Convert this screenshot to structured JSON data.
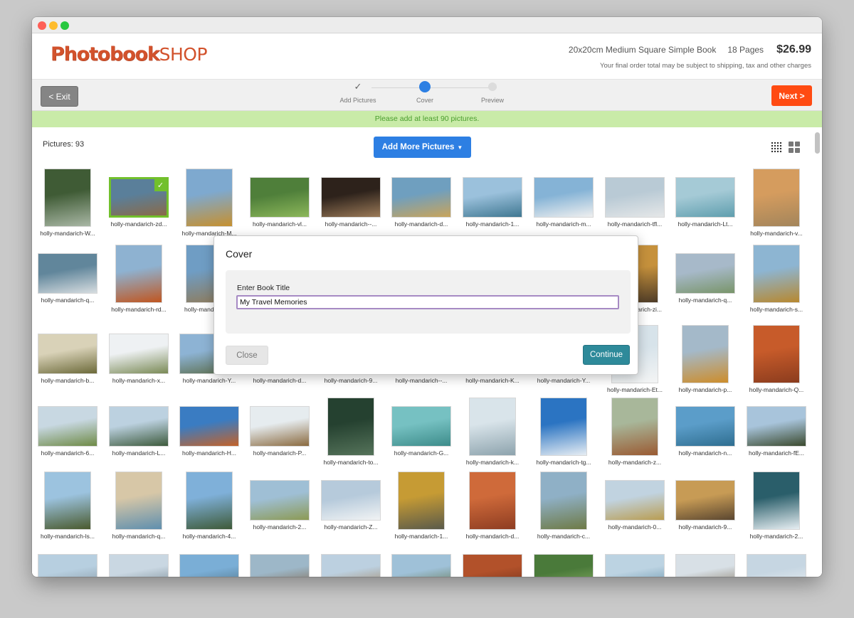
{
  "header": {
    "logo_bold": "Photobook",
    "logo_light": "SHOP",
    "product_name": "20x20cm Medium Square Simple Book",
    "pages": "18 Pages",
    "price": "$26.99",
    "note": "Your final order total may be subject to shipping, tax and other charges"
  },
  "toolbar": {
    "exit_label": "< Exit",
    "next_label": "Next >",
    "steps": [
      {
        "label": "Add Pictures",
        "state": "done"
      },
      {
        "label": "Cover",
        "state": "active"
      },
      {
        "label": "Preview",
        "state": "todo"
      }
    ]
  },
  "alert": {
    "text": "Please add at least 90 pictures."
  },
  "gallery": {
    "count_label": "Pictures: 93",
    "add_button": "Add More Pictures",
    "photos": [
      {
        "name": "holly-mandarich-W...",
        "c1": "#3f5b35",
        "c2": "#a9b7a5",
        "o": "p",
        "sel": false
      },
      {
        "name": "holly-mandarich-zd...",
        "c1": "#5a7f9a",
        "c2": "#8a6a48",
        "o": "l",
        "sel": true
      },
      {
        "name": "holly-mandarich-M...",
        "c1": "#7ea9cf",
        "c2": "#c6902f",
        "o": "p",
        "sel": false
      },
      {
        "name": "holly-mandarich-vl...",
        "c1": "#4f7f3a",
        "c2": "#8cb75a",
        "o": "l",
        "sel": false
      },
      {
        "name": "holly-mandarich--...",
        "c1": "#2d221b",
        "c2": "#9b7a58",
        "o": "l",
        "sel": false
      },
      {
        "name": "holly-mandarich-d...",
        "c1": "#6f9fbf",
        "c2": "#c9a45a",
        "o": "l",
        "sel": false
      },
      {
        "name": "holly-mandarich-1...",
        "c1": "#9bc1dc",
        "c2": "#3f7791",
        "o": "l",
        "sel": false
      },
      {
        "name": "holly-mandarich-m...",
        "c1": "#85b3d6",
        "c2": "#efefef",
        "o": "l",
        "sel": false
      },
      {
        "name": "holly-mandarich-tfl...",
        "c1": "#b9cad5",
        "c2": "#e5e7e8",
        "o": "l",
        "sel": false
      },
      {
        "name": "holly-mandarich-Lt...",
        "c1": "#a5cad6",
        "c2": "#5f9eae",
        "o": "l",
        "sel": false
      },
      {
        "name": "holly-mandarich-v...",
        "c1": "#d59c5e",
        "c2": "#a3855b",
        "o": "p",
        "sel": false
      },
      {
        "name": "holly-mandarich-q...",
        "c1": "#61869b",
        "c2": "#d7dde0",
        "o": "l",
        "sel": false
      },
      {
        "name": "holly-mandarich-rd...",
        "c1": "#8eb2d1",
        "c2": "#c05620",
        "o": "p",
        "sel": false
      },
      {
        "name": "holly-mandarich-...",
        "c1": "#6f9dc4",
        "c2": "#8f7b5a",
        "o": "p",
        "sel": false
      },
      {
        "name": "",
        "c1": "#ffffff",
        "c2": "#ffffff",
        "o": "l",
        "sel": false
      },
      {
        "name": "",
        "c1": "#ffffff",
        "c2": "#ffffff",
        "o": "l",
        "sel": false
      },
      {
        "name": "",
        "c1": "#ffffff",
        "c2": "#ffffff",
        "o": "l",
        "sel": false
      },
      {
        "name": "",
        "c1": "#ffffff",
        "c2": "#ffffff",
        "o": "l",
        "sel": false
      },
      {
        "name": "",
        "c1": "#ffffff",
        "c2": "#ffffff",
        "o": "l",
        "sel": false
      },
      {
        "name": "holly-mandarich-zi...",
        "c1": "#c6913c",
        "c2": "#4d3b27",
        "o": "p",
        "sel": false
      },
      {
        "name": "holly-mandarich-q...",
        "c1": "#a7b9c9",
        "c2": "#79956a",
        "o": "l",
        "sel": false
      },
      {
        "name": "holly-mandarich-s...",
        "c1": "#8db5d2",
        "c2": "#b7882f",
        "o": "p",
        "sel": false
      },
      {
        "name": "holly-mandarich-b...",
        "c1": "#d9d2b8",
        "c2": "#6c6a3a",
        "o": "l",
        "sel": false
      },
      {
        "name": "holly-mandarich-x...",
        "c1": "#eef1f3",
        "c2": "#7a8a56",
        "o": "l",
        "sel": false
      },
      {
        "name": "holly-mandarich-Y...",
        "c1": "#8db3d4",
        "c2": "#5b6d4b",
        "o": "l",
        "sel": false
      },
      {
        "name": "holly-mandarich-d...",
        "c1": "#ffffff",
        "c2": "#ffffff",
        "o": "l",
        "sel": false
      },
      {
        "name": "holly-mandarich-9...",
        "c1": "#ffffff",
        "c2": "#ffffff",
        "o": "l",
        "sel": false
      },
      {
        "name": "holly-mandarich--...",
        "c1": "#ffffff",
        "c2": "#ffffff",
        "o": "l",
        "sel": false
      },
      {
        "name": "holly-mandarich-K...",
        "c1": "#ffffff",
        "c2": "#ffffff",
        "o": "l",
        "sel": false
      },
      {
        "name": "holly-mandarich-Y...",
        "c1": "#ffffff",
        "c2": "#ffffff",
        "o": "l",
        "sel": false
      },
      {
        "name": "holly-mandarich-Et...",
        "c1": "#d7e3ea",
        "c2": "#f3f4f4",
        "o": "p",
        "sel": false
      },
      {
        "name": "holly-mandarich-p...",
        "c1": "#a4b9c9",
        "c2": "#cd8d2b",
        "o": "p",
        "sel": false
      },
      {
        "name": "holly-mandarich-Q...",
        "c1": "#c75b2a",
        "c2": "#8b3c1e",
        "o": "p",
        "sel": false
      },
      {
        "name": "holly-mandarich-6...",
        "c1": "#c8d8e2",
        "c2": "#6e8a46",
        "o": "l",
        "sel": false
      },
      {
        "name": "holly-mandarich-L...",
        "c1": "#bcd1e0",
        "c2": "#3d5a3c",
        "o": "l",
        "sel": false
      },
      {
        "name": "holly-mandarich-H...",
        "c1": "#3a7cc2",
        "c2": "#c3622a",
        "o": "l",
        "sel": false
      },
      {
        "name": "holly-mandarich-P...",
        "c1": "#e6ecef",
        "c2": "#8a6a3f",
        "o": "l",
        "sel": false
      },
      {
        "name": "holly-mandarich-to...",
        "c1": "#254130",
        "c2": "#55735a",
        "o": "p",
        "sel": false
      },
      {
        "name": "holly-mandarich-G...",
        "c1": "#76c1c2",
        "c2": "#3d8c8a",
        "o": "l",
        "sel": false
      },
      {
        "name": "holly-mandarich-k...",
        "c1": "#d9e4ea",
        "c2": "#8da3ad",
        "o": "p",
        "sel": false
      },
      {
        "name": "holly-mandarich-tg...",
        "c1": "#2b74c2",
        "c2": "#e6edf3",
        "o": "p",
        "sel": false
      },
      {
        "name": "holly-mandarich-z...",
        "c1": "#a8b79a",
        "c2": "#9a5a32",
        "o": "p",
        "sel": false
      },
      {
        "name": "holly-mandarich-n...",
        "c1": "#5b9dc9",
        "c2": "#2f6e90",
        "o": "l",
        "sel": false
      },
      {
        "name": "holly-mandarich-fE...",
        "c1": "#a8c4db",
        "c2": "#3b4a2e",
        "o": "l",
        "sel": false
      },
      {
        "name": "holly-mandarich-ls...",
        "c1": "#9cc3df",
        "c2": "#4a5a2e",
        "o": "p",
        "sel": false
      },
      {
        "name": "holly-mandarich-q...",
        "c1": "#d7c7a7",
        "c2": "#5f8fae",
        "o": "p",
        "sel": false
      },
      {
        "name": "holly-mandarich-4...",
        "c1": "#7fb0d9",
        "c2": "#3e5a38",
        "o": "p",
        "sel": false
      },
      {
        "name": "holly-mandarich-2...",
        "c1": "#9fbfd5",
        "c2": "#8c9a54",
        "o": "l",
        "sel": false
      },
      {
        "name": "holly-mandarich-Z...",
        "c1": "#b6cadb",
        "c2": "#f1f3f4",
        "o": "l",
        "sel": false
      },
      {
        "name": "holly-mandarich-1...",
        "c1": "#c69b34",
        "c2": "#5a5a4a",
        "o": "p",
        "sel": false
      },
      {
        "name": "holly-mandarich-d...",
        "c1": "#cf6a3a",
        "c2": "#8e3d22",
        "o": "p",
        "sel": false
      },
      {
        "name": "holly-mandarich-c...",
        "c1": "#8fb0c6",
        "c2": "#6e7a46",
        "o": "p",
        "sel": false
      },
      {
        "name": "holly-mandarich-0...",
        "c1": "#c1d3e0",
        "c2": "#b99d52",
        "o": "l",
        "sel": false
      },
      {
        "name": "holly-mandarich-9...",
        "c1": "#c79b55",
        "c2": "#5a4630",
        "o": "l",
        "sel": false
      },
      {
        "name": "holly-mandarich-2...",
        "c1": "#2a5e6a",
        "c2": "#e6eef2",
        "o": "p",
        "sel": false
      },
      {
        "name": "",
        "c1": "#b7cfe0",
        "c2": "#7f8f9a",
        "o": "l",
        "sel": false
      },
      {
        "name": "",
        "c1": "#c9d7e2",
        "c2": "#6a7c86",
        "o": "l",
        "sel": false
      },
      {
        "name": "",
        "c1": "#7aaed6",
        "c2": "#4a6a7a",
        "o": "l",
        "sel": false
      },
      {
        "name": "",
        "c1": "#9db7c8",
        "c2": "#7a5a3a",
        "o": "l",
        "sel": false
      },
      {
        "name": "",
        "c1": "#bcd0e0",
        "c2": "#9b7a52",
        "o": "l",
        "sel": false
      },
      {
        "name": "",
        "c1": "#9fc1d8",
        "c2": "#5a6a3a",
        "o": "l",
        "sel": false
      },
      {
        "name": "",
        "c1": "#b2512a",
        "c2": "#6a2e1a",
        "o": "l",
        "sel": false
      },
      {
        "name": "",
        "c1": "#4a7a3a",
        "c2": "#8fb56a",
        "o": "l",
        "sel": false
      },
      {
        "name": "",
        "c1": "#bcd3e2",
        "c2": "#5a8aa3",
        "o": "l",
        "sel": false
      },
      {
        "name": "",
        "c1": "#d8e0e6",
        "c2": "#7a6a52",
        "o": "l",
        "sel": false
      },
      {
        "name": "",
        "c1": "#c6d6e2",
        "c2": "#eef1f3",
        "o": "l",
        "sel": false
      }
    ]
  },
  "modal": {
    "title": "Cover",
    "field_label": "Enter Book Title",
    "input_value": "My Travel Memories",
    "close_label": "Close",
    "continue_label": "Continue"
  },
  "colors": {
    "brand": "#d2522c",
    "primary": "#2d7fe3",
    "next": "#ff4b12",
    "alert_bg": "#c9eba8",
    "selected": "#72c02c",
    "continue": "#2e8a9a"
  }
}
